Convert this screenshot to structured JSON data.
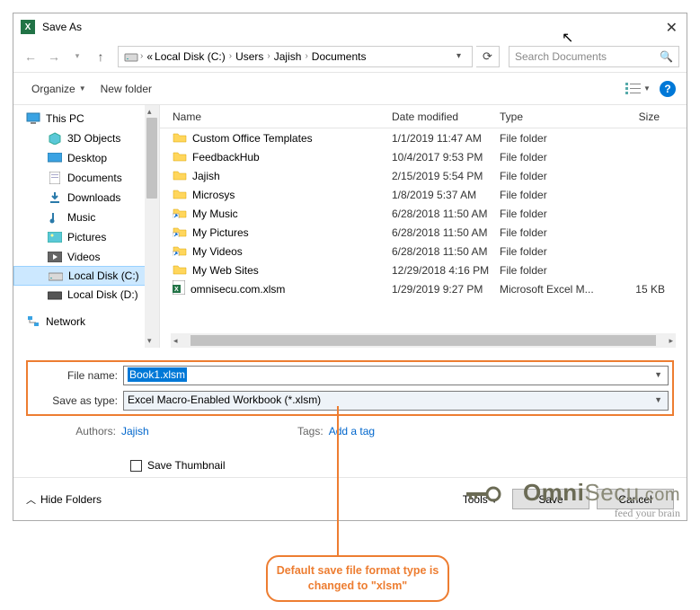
{
  "title": "Save As",
  "breadcrumb": {
    "pre": "«",
    "p1": "Local Disk (C:)",
    "p2": "Users",
    "p3": "Jajish",
    "p4": "Documents"
  },
  "search": {
    "placeholder": "Search Documents"
  },
  "toolbar": {
    "organize": "Organize",
    "newfolder": "New folder"
  },
  "tree": {
    "thispc": "This PC",
    "items": [
      "3D Objects",
      "Desktop",
      "Documents",
      "Downloads",
      "Music",
      "Pictures",
      "Videos",
      "Local Disk (C:)",
      "Local Disk (D:)"
    ],
    "network": "Network"
  },
  "cols": {
    "name": "Name",
    "date": "Date modified",
    "type": "Type",
    "size": "Size"
  },
  "files": [
    {
      "name": "Custom Office Templates",
      "date": "1/1/2019 11:47 AM",
      "type": "File folder",
      "size": "",
      "kind": "folder"
    },
    {
      "name": "FeedbackHub",
      "date": "10/4/2017 9:53 PM",
      "type": "File folder",
      "size": "",
      "kind": "folder"
    },
    {
      "name": "Jajish",
      "date": "2/15/2019 5:54 PM",
      "type": "File folder",
      "size": "",
      "kind": "folder"
    },
    {
      "name": "Microsys",
      "date": "1/8/2019 5:37 AM",
      "type": "File folder",
      "size": "",
      "kind": "folder"
    },
    {
      "name": "My Music",
      "date": "6/28/2018 11:50 AM",
      "type": "File folder",
      "size": "",
      "kind": "shortcut"
    },
    {
      "name": "My Pictures",
      "date": "6/28/2018 11:50 AM",
      "type": "File folder",
      "size": "",
      "kind": "shortcut"
    },
    {
      "name": "My Videos",
      "date": "6/28/2018 11:50 AM",
      "type": "File folder",
      "size": "",
      "kind": "shortcut"
    },
    {
      "name": "My Web Sites",
      "date": "12/29/2018 4:16 PM",
      "type": "File folder",
      "size": "",
      "kind": "folder"
    },
    {
      "name": "omnisecu.com.xlsm",
      "date": "1/29/2019 9:27 PM",
      "type": "Microsoft Excel M...",
      "size": "15 KB",
      "kind": "xlsm"
    }
  ],
  "form": {
    "filename_label": "File name:",
    "filename_value": "Book1.xlsm",
    "saveastype_label": "Save as type:",
    "saveastype_value": "Excel Macro-Enabled Workbook (*.xlsm)",
    "authors_label": "Authors:",
    "authors_value": "Jajish",
    "tags_label": "Tags:",
    "tags_value": "Add a tag",
    "savethumb": "Save Thumbnail"
  },
  "footer": {
    "hide": "Hide Folders",
    "tools": "Tools",
    "save": "Save",
    "cancel": "Cancel"
  },
  "callout": "Default save file format type is changed to \"xlsm\"",
  "watermark": {
    "line1a": "Omni",
    "line1b": "Secu",
    "line1c": ".com",
    "line2": "feed your brain"
  }
}
